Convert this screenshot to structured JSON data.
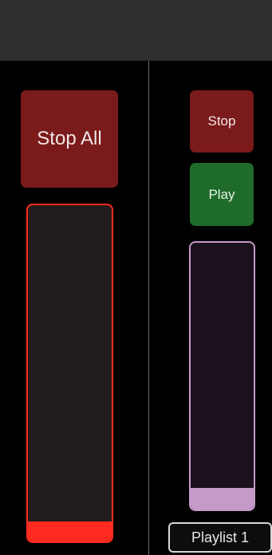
{
  "master": {
    "stop_all_label": "Stop All",
    "fader_level": 0.06
  },
  "playlist": {
    "stop_label": "Stop",
    "play_label": "Play",
    "fader_level": 0.08,
    "name": "Playlist 1"
  },
  "colors": {
    "header": "#2f2f2f",
    "stop": "#7a1a1a",
    "play": "#1f6b2a",
    "master_fader": "#ff2a20",
    "playlist_fader": "#c69ac8"
  }
}
